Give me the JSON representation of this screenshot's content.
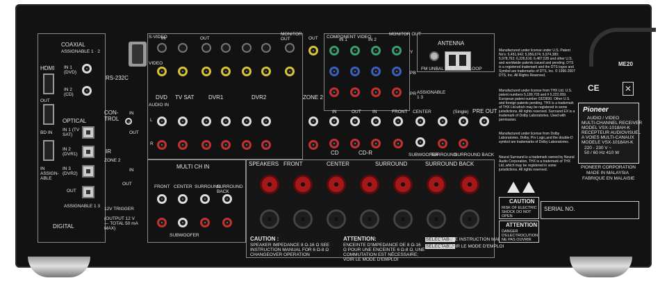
{
  "left": {
    "coaxial": "COAXIAL",
    "assignable_12": "ASSIGNABLE 1 · 2",
    "hdmi": "HDMI",
    "in1_dvd": "IN 1 (DVD)",
    "in2_cd": "IN 2 (CD)",
    "out": "OUT",
    "bd_in": "BD IN",
    "in_assignable": "IN ASSIGN-ABLE",
    "optical": "OPTICAL",
    "opt_in1": "IN 1 (TV SAT)",
    "opt_in2": "IN 2 (DVR1)",
    "opt_in3": "IN 3 (DVR2)",
    "out2": "OUT",
    "assignable_13": "ASSIGNABLE 1 3",
    "digital": "DIGITAL",
    "rs232": "RS-232C",
    "control": "CON-TROL",
    "in": "IN",
    "out3": "OUT",
    "ir": "IR",
    "zone2": "ZONE 2",
    "in2": "IN",
    "out4": "OUT",
    "trigger": "12V TRIGGER",
    "trigger_note": "(OUTPUT 12 V — TOTAL 50 mA MAX)"
  },
  "video": {
    "svideo": "S-VIDEO",
    "video": "VIDEO",
    "in": "IN",
    "out": "OUT",
    "monitor_out": "MONITOR OUT",
    "zone2_out": "OUT",
    "audio_in": "AUDIO IN",
    "dvd": "DVD",
    "tvsat": "TV SAT",
    "dvr1": "DVR1",
    "dvr2": "DVR2",
    "zone2": "ZONE 2",
    "l": "L",
    "r": "R"
  },
  "component": {
    "title": "COMPONENT VIDEO",
    "in1": "IN 1",
    "in2": "IN 2",
    "monitor_out": "MONITOR OUT",
    "y": "Y",
    "pb": "PB",
    "pr": "PR",
    "assignable": "ASSIGNABLE 1 3"
  },
  "audio": {
    "in": "IN",
    "out": "OUT",
    "in2": "IN",
    "cd": "CD",
    "cdr": "CD-R",
    "front": "FRONT",
    "center": "CENTER",
    "single": "(Single)",
    "preout": "PRE OUT",
    "subwoofer": "SUBWOOFER",
    "surround": "SURROUND",
    "surround_back": "SURROUND BACK"
  },
  "multich": {
    "title": "MULTI CH IN",
    "front": "FRONT",
    "center": "CENTER",
    "surround": "SURROUND",
    "surround_back": "SURROUND BACK",
    "subwoofer": "SUBWOOFER"
  },
  "speakers": {
    "title": "SPEAKERS",
    "front": "FRONT",
    "center": "CENTER",
    "surround": "SURROUND",
    "surround_back": "SURROUND BACK",
    "caution_title": "CAUTION :",
    "caution_text": "SPEAKER IMPEDANCE 8 Ω-16 Ω SEE INSTRUCTION MANUAL FOR 6 Ω-8 Ω CHANGEOVER OPERATION",
    "attention_title": "ATTENTION:",
    "attention_text": "ENCEINTE D'IMPEDANCE DE 8 Ω-16 Ω POUR UNE ENCEINTE 6 Ω-8 Ω, UNE COMMUTATION EST NÉCESSAIRE; VOIR LE MODE D'EMPLOI",
    "selectable_1": "SELECTABLE",
    "selectable_1_text": "SEE INSTRUCTION MANUAL",
    "selectable_2": "SELECTABLE",
    "selectable_2_text": "VOIR LE MODE D'EMPLOI"
  },
  "antenna": {
    "title": "ANTENNA",
    "fm": "FM UNBAL 75 Ω",
    "am": "AM LOOP"
  },
  "legal": {
    "dts": "Manufactured under license under U.S. Patent No's: 5,451,942; 5,956,674; 5,974,380; 5,978,762; 6,226,616; 6,487,535 and other U.S. and worldwide patents issued and pending. DTS is a registered trademark and the DTS logos and Symbol are trademarks of DTS, Inc. © 1996-2007 DTS, Inc. All Rights Reserved.",
    "thx": "Manufactured under license from THX Ltd. U.S. patent numbers 5,189,703 and # 5,222,059. European patent number 0323830. Other U.S. and foreign patents pending. THX is a trademark of THX Ltd.which may be registered in some jurisdictions. All rights reserved. Surround EX is a trademark of Dolby Laboratories. Used with permission.",
    "dolby": "Manufactured under license from Dolby Laboratories. Dolby, Pro Logic,and the double-D symbol are trademarks of Dolby Laboratories.",
    "neural": "Neural Surround is a trademark owned by Neural Audio Corporation, THX is a trademark of THX Ltd.,which may be registered in some jurisdictions. All rights reserved."
  },
  "rating": {
    "model_code": "ME20",
    "brand": "Pioneer",
    "line1": "AUDIO / VIDEO",
    "line2": "MULTI-CHANNEL RECEIVER",
    "line3": "MODEL VSX-1018AH-K",
    "line4": "RECEPTEUR AUDIOVISUEL",
    "line5": "A VOIES MULTI-CANAUX",
    "line6": "MODELE VSX-1018AH-K",
    "voltage": "220 - 230 V ~",
    "power": "50 / 60 Hz   410 W",
    "corp": "PIONEER CORPORATION",
    "made": "MADE IN MALAYSIA",
    "fab": "FABRIQUE EN MALAISIE",
    "ce": "CE"
  },
  "warnings": {
    "caution": "CAUTION",
    "caution_text": "RISK OF ELECTRIC SHOCK DO NOT OPEN",
    "attention": "ATTENTION",
    "attention_text": "DANGER D'ELECTROCUTION NE PAS OUVRIR",
    "serial": "SERIAL NO."
  },
  "colors": {
    "chassis": "#121212",
    "red_terminal": "#a41818",
    "label_text": "#e8e8e8"
  }
}
